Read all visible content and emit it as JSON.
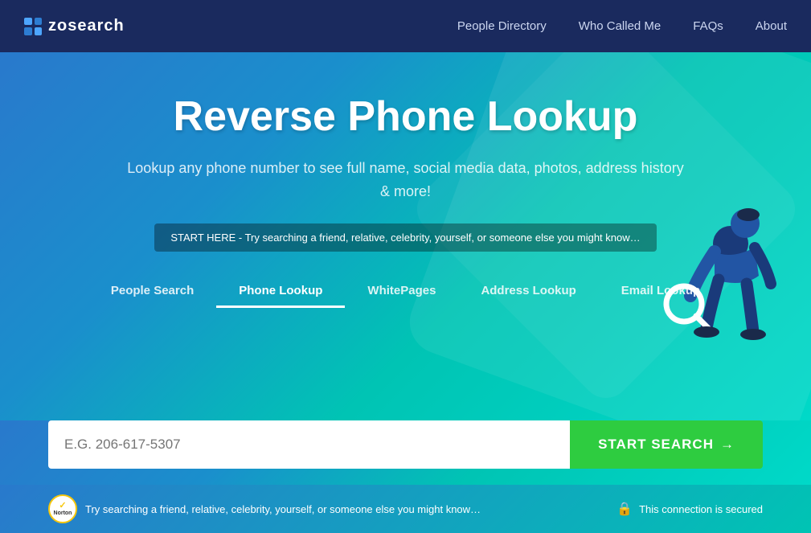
{
  "nav": {
    "logo_text": "zosearch",
    "links": [
      {
        "label": "People Directory",
        "id": "people-directory"
      },
      {
        "label": "Who Called Me",
        "id": "who-called-me"
      },
      {
        "label": "FAQs",
        "id": "faqs"
      },
      {
        "label": "About",
        "id": "about"
      }
    ]
  },
  "hero": {
    "title": "Reverse Phone Lookup",
    "subtitle": "Lookup any phone number to see full name, social media data, photos, address history & more!",
    "banner": "START HERE - Try searching a friend, relative, celebrity, yourself, or someone else you might know…"
  },
  "tabs": [
    {
      "label": "People Search",
      "id": "people-search",
      "active": false
    },
    {
      "label": "Phone Lookup",
      "id": "phone-lookup",
      "active": true
    },
    {
      "label": "WhitePages",
      "id": "whitepages",
      "active": false
    },
    {
      "label": "Address Lookup",
      "id": "address-lookup",
      "active": false
    },
    {
      "label": "Email Lookup",
      "id": "email-lookup",
      "active": false
    }
  ],
  "search": {
    "placeholder": "E.G. 206-617-5307",
    "button_label": "START SEARCH",
    "button_arrow": "→"
  },
  "footer": {
    "norton_text": "Try searching a friend, relative, celebrity, yourself, or someone else you might know…",
    "norton_label": "Norton",
    "secure_text": "This connection is secured"
  }
}
